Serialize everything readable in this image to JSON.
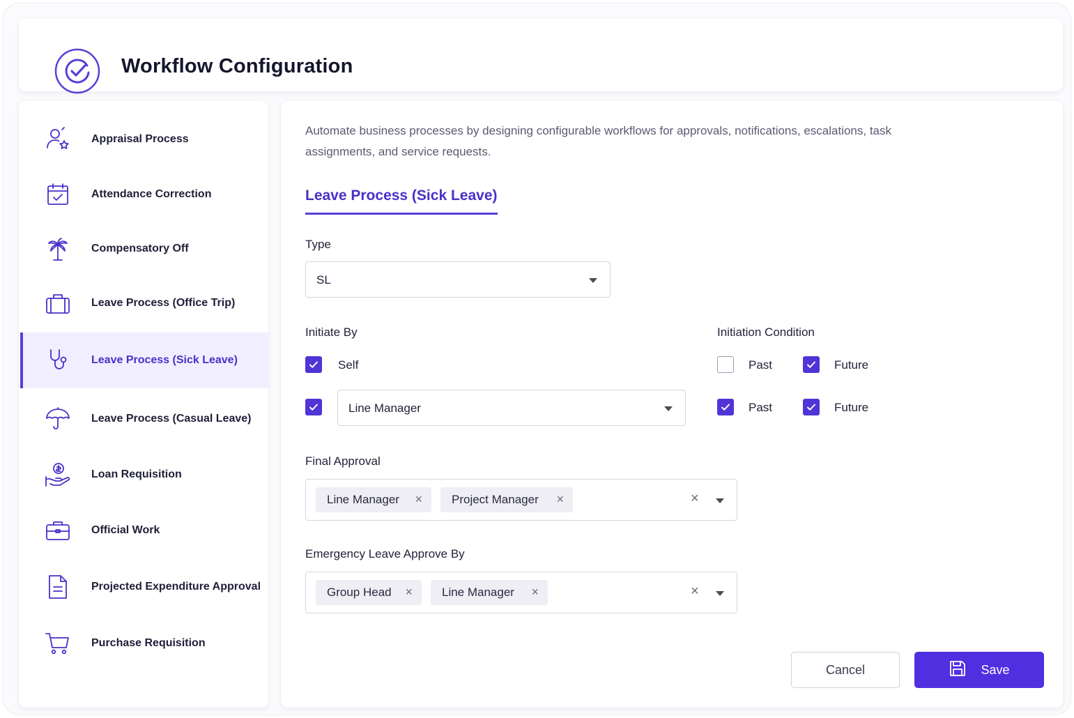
{
  "header": {
    "title": "Workflow Configuration",
    "logo_icon": "circle-check-icon"
  },
  "sidebar": {
    "items": [
      {
        "label": "Appraisal Process",
        "icon": "user-star-icon"
      },
      {
        "label": "Attendance Correction",
        "icon": "calendar-check-icon"
      },
      {
        "label": "Compensatory Off",
        "icon": "palm-tree-icon"
      },
      {
        "label": "Leave Process (Office Trip)",
        "icon": "suitcase-icon"
      },
      {
        "label": "Leave Process (Sick Leave)",
        "icon": "stethoscope-icon",
        "active": true
      },
      {
        "label": "Leave Process (Casual Leave)",
        "icon": "umbrella-icon"
      },
      {
        "label": "Loan Requisition",
        "icon": "hand-coin-icon"
      },
      {
        "label": "Official Work",
        "icon": "briefcase-icon"
      },
      {
        "label": "Projected Expenditure Approval",
        "icon": "document-icon"
      },
      {
        "label": "Purchase Requisition",
        "icon": "cart-icon"
      }
    ]
  },
  "main": {
    "description": "Automate business processes by designing configurable workflows for approvals, notifications, escalations, task assignments, and service requests.",
    "tab": "Leave Process (Sick Leave)",
    "type": {
      "label": "Type",
      "value": "SL"
    },
    "initiate_by": {
      "label": "Initiate By",
      "self": {
        "label": "Self",
        "checked": true
      },
      "other": {
        "checked": true,
        "value": "Line Manager"
      }
    },
    "initiation_condition": {
      "label": "Initiation Condition",
      "row1": {
        "past": {
          "label": "Past",
          "checked": false
        },
        "future": {
          "label": "Future",
          "checked": true
        }
      },
      "row2": {
        "past": {
          "label": "Past",
          "checked": true
        },
        "future": {
          "label": "Future",
          "checked": true
        }
      }
    },
    "final_approval": {
      "label": "Final Approval",
      "chips": [
        "Line Manager",
        "Project Manager"
      ]
    },
    "emergency": {
      "label": "Emergency Leave Approve By",
      "chips": [
        "Group Head",
        "Line Manager"
      ]
    },
    "chip_remove": "×",
    "clear_all": "×"
  },
  "buttons": {
    "cancel": "Cancel",
    "save": "Save"
  },
  "colors": {
    "accent": "#5134d6",
    "active_bg": "#f1efff",
    "save_bg": "#4f2fe0"
  }
}
